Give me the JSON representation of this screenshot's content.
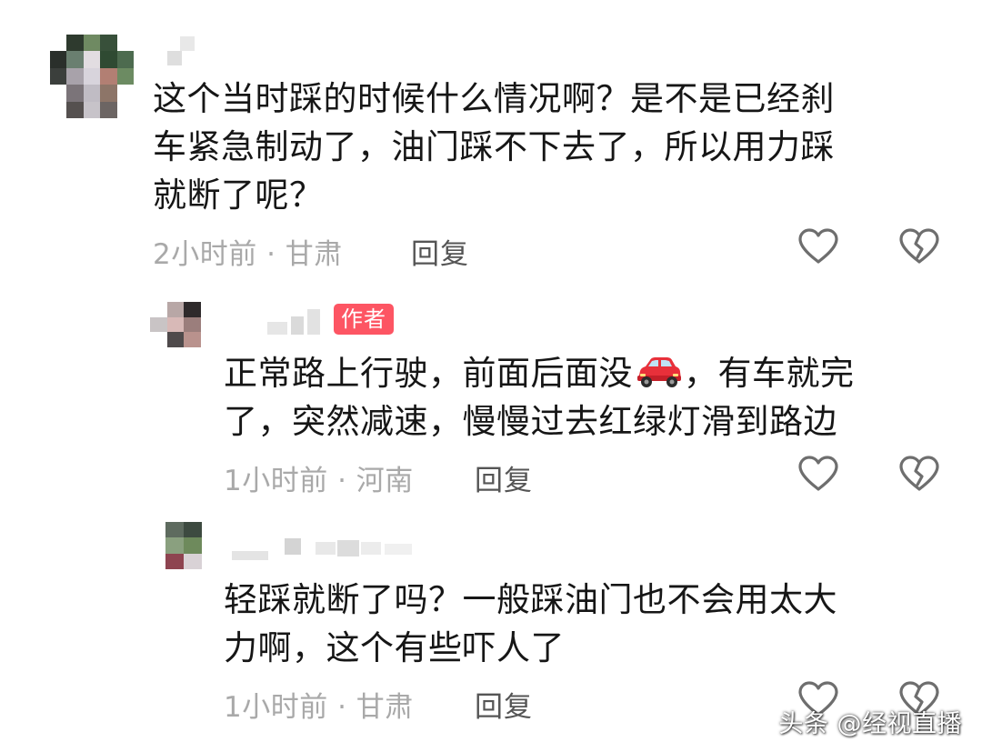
{
  "comments": [
    {
      "text_line1": "这个当时踩的时候什么情况啊？是不是已经刹",
      "text_line2": "车紧急制动了，油门踩不下去了，所以用力踩",
      "text_line3": "就断了呢？",
      "time_location": "2小时前 · 甘肃",
      "reply_label": "回复",
      "replies": [
        {
          "author_badge": "作者",
          "text_line1_before": "正常路上行驶，前面后面没",
          "text_line1_after": "，有车就完",
          "text_line2": "了，突然减速，慢慢过去红绿灯滑到路边",
          "time_location": "1小时前 · 河南",
          "reply_label": "回复"
        },
        {
          "text_line1": "轻踩就断了吗？一般踩油门也不会用太大",
          "text_line2": "力啊，这个有些吓人了",
          "time_location": "1小时前 · 甘肃",
          "reply_label": "回复"
        }
      ]
    }
  ],
  "icons": {
    "like": "heart-outline-icon",
    "dislike": "broken-heart-icon",
    "emoji": "red-car-emoji"
  },
  "colors": {
    "author_badge": "#fd5563",
    "meta_text": "#a9a9a9",
    "reply_link": "#555555",
    "icon_stroke": "#6e6e6e"
  },
  "watermark": "头条 @经视直播"
}
